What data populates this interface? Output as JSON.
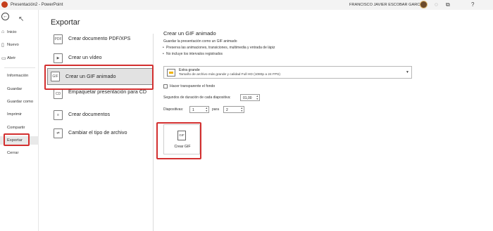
{
  "titlebar": {
    "doc_title": "Presentación2 - PowerPoint",
    "user_name": "FRANCISCO JAVIER ESCOBAR GARCIA",
    "icons": [
      "powerpoint-app-icon",
      "lightbulb-icon",
      "share-icon",
      "help-icon"
    ]
  },
  "nav": {
    "items": [
      {
        "label": "Inicio",
        "icon": "home-icon"
      },
      {
        "label": "Nuevo",
        "icon": "new-icon"
      },
      {
        "label": "Abrir",
        "icon": "folder-icon"
      },
      {
        "label": "Información"
      },
      {
        "label": "Guardar"
      },
      {
        "label": "Guardar como"
      },
      {
        "label": "Imprimir"
      },
      {
        "label": "Compartir"
      },
      {
        "label": "Exportar",
        "active": true
      },
      {
        "label": "Cerrar"
      }
    ]
  },
  "main": {
    "title": "Exportar",
    "options": [
      {
        "label": "Crear documento PDF/XPS",
        "icon_text": "PDF"
      },
      {
        "label": "Crear un vídeo",
        "icon_text": "▶"
      },
      {
        "label": "Crear un GIF animado",
        "icon_text": "GIF",
        "selected": true
      },
      {
        "label": "Empaquetar presentación para CD",
        "icon_text": "CD"
      },
      {
        "label": "Crear documentos",
        "icon_text": "≡"
      },
      {
        "label": "Cambiar el tipo de archivo",
        "icon_text": "⇄"
      }
    ]
  },
  "panel": {
    "title": "Crear un GIF animado",
    "desc": "Guardar la presentación como un GIF animado",
    "bullets": [
      "Preserva las animaciones, transiciones, multimedia y entrada de lápiz",
      "No incluye los intervalos registrados"
    ],
    "quality": {
      "title": "Extra grande",
      "subtitle": "Tamaño de archivo más grande y calidad Full HD (1080p a 24 FPS)"
    },
    "transparent_label": "Hacer transparente el fondo",
    "seconds_label": "Segundos de duración de cada diapositiva:",
    "seconds_value": "01,00",
    "slides_label": "Diapositivas:",
    "slides_from": "1",
    "slides_to_label": "para",
    "slides_to": "2",
    "create_button": "Crear GIF",
    "create_icon_text": "GIF"
  }
}
